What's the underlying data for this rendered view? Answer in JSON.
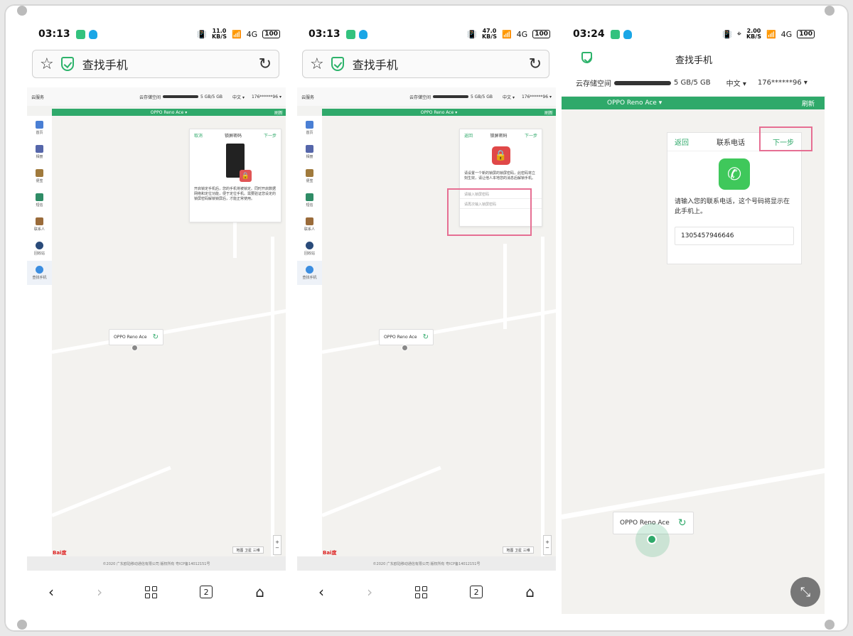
{
  "status1": {
    "time": "03:13",
    "speed": "11.0",
    "speed_unit": "KB/S",
    "net": "4G",
    "battery": "100"
  },
  "status2": {
    "time": "03:13",
    "speed": "47.0",
    "speed_unit": "KB/S",
    "net": "4G",
    "battery": "100"
  },
  "status3": {
    "time": "03:24",
    "speed": "2.00",
    "speed_unit": "KB/S",
    "net": "4G",
    "battery": "100"
  },
  "browser": {
    "page_title": "查找手机",
    "tab_count": "2"
  },
  "web": {
    "cloud_service": "云服务",
    "storage_label": "云存储空间",
    "storage_value": "5 GB/5 GB",
    "language": "中文",
    "account": "176******96",
    "device_name": "OPPO Reno Ace",
    "refresh": "刷新",
    "footer": "©2020 广东欧珀移动通信有限公司 版权所有 粤ICP备14012151号",
    "sidebar": [
      "首页",
      "相册",
      "便签",
      "短信",
      "联系人",
      "回收站",
      "查找手机"
    ],
    "map_controls": {
      "zoom_in": "+",
      "zoom_out": "−",
      "map": "地图",
      "satellite": "卫星",
      "three_d": "三维",
      "baidu": "Bai度"
    }
  },
  "card1": {
    "cancel": "取消",
    "title": "锁屏密码",
    "next": "下一步",
    "desc": "开启锁定手机后，您的手机将被锁定。同时开启数据网络和定位功能，便于定位手机。需要验证您设定的锁屏密码解锁锁屏后，才能正常使用。"
  },
  "card2": {
    "back": "返回",
    "title": "锁屏密码",
    "next": "下一步",
    "desc": "请设置一个新的锁屏的锁屏密码，此密码将立刻生效，请让他人本地您的消息后解锁手机。",
    "input1_placeholder": "请输入锁屏密码",
    "input2_placeholder": "请再次输入锁屏密码"
  },
  "panel3": {
    "app_title": "查找手机",
    "storage_label": "云存储空间",
    "storage_value": "5 GB/5 GB",
    "language": "中文",
    "account": "176******96",
    "device_name": "OPPO Reno Ace",
    "refresh": "刷新",
    "card": {
      "back": "返回",
      "title": "联系电话",
      "next": "下一步",
      "desc": "请输入您的联系电话，这个号码将显示在此手机上。",
      "phone_value": "1305457946646"
    }
  },
  "colors": {
    "accent": "#2fa96a",
    "highlight": "#e66f93",
    "lock": "#e04848",
    "phone_icon": "#3fc85b"
  },
  "icons": [
    "star-icon",
    "shield-icon",
    "reload-icon",
    "back-icon",
    "forward-icon",
    "grid-icon",
    "tabs-icon",
    "home-icon",
    "lock-icon",
    "phone-icon",
    "collapse-icon"
  ]
}
